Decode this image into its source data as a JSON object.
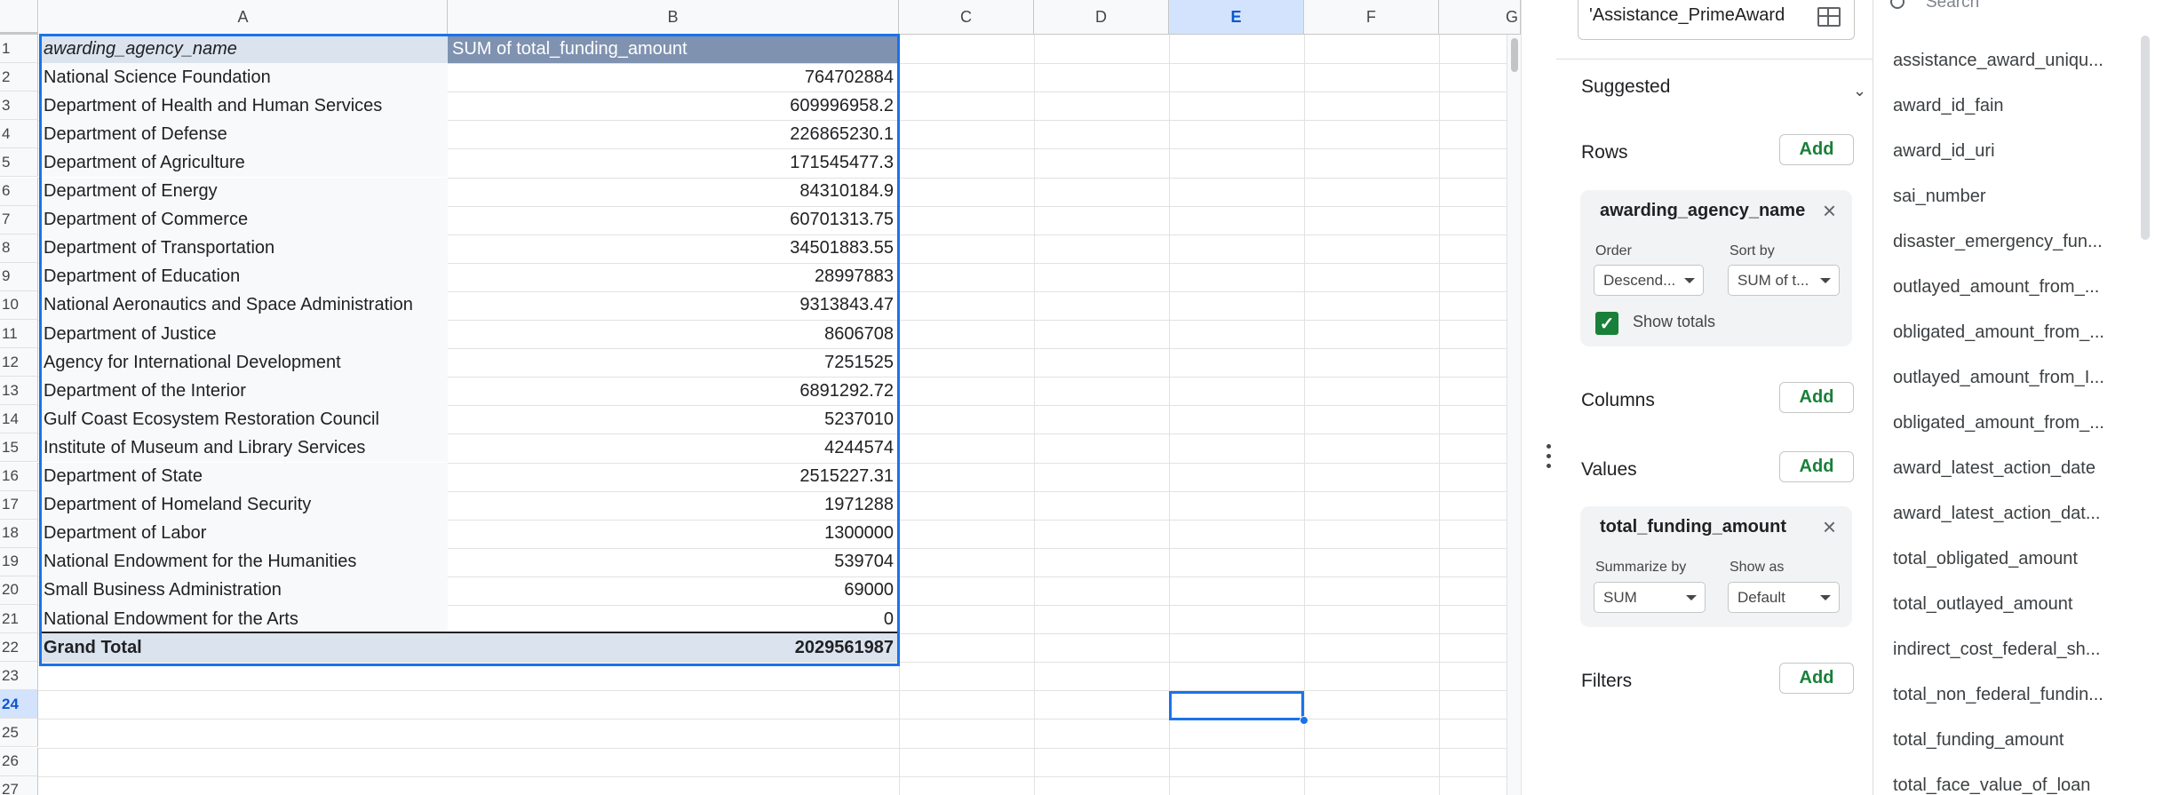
{
  "sheet": {
    "columns": [
      "A",
      "B",
      "C",
      "D",
      "E",
      "F",
      "G"
    ],
    "selected_column": "E",
    "selected_row": "24",
    "rows": [
      "1",
      "2",
      "3",
      "4",
      "5",
      "6",
      "7",
      "8",
      "9",
      "10",
      "11",
      "12",
      "13",
      "14",
      "15",
      "16",
      "17",
      "18",
      "19",
      "20",
      "21",
      "22",
      "23",
      "24",
      "25",
      "26",
      "27"
    ],
    "pivot": {
      "header_a": "awarding_agency_name",
      "header_b": "SUM of total_funding_amount",
      "data": [
        {
          "agency": "National Science Foundation",
          "amount": "764702884"
        },
        {
          "agency": "Department of Health and Human Services",
          "amount": "609996958.2"
        },
        {
          "agency": "Department of Defense",
          "amount": "226865230.1"
        },
        {
          "agency": "Department of Agriculture",
          "amount": "171545477.3"
        },
        {
          "agency": "Department of Energy",
          "amount": "84310184.9"
        },
        {
          "agency": "Department of Commerce",
          "amount": "60701313.75"
        },
        {
          "agency": "Department of Transportation",
          "amount": "34501883.55"
        },
        {
          "agency": "Department of Education",
          "amount": "28997883"
        },
        {
          "agency": "National Aeronautics and Space Administration",
          "amount": "9313843.47"
        },
        {
          "agency": "Department of Justice",
          "amount": "8606708"
        },
        {
          "agency": "Agency for International Development",
          "amount": "7251525"
        },
        {
          "agency": "Department of the Interior",
          "amount": "6891292.72"
        },
        {
          "agency": "Gulf Coast Ecosystem Restoration Council",
          "amount": "5237010"
        },
        {
          "agency": "Institute of Museum and Library Services",
          "amount": "4244574"
        },
        {
          "agency": "Department of State",
          "amount": "2515227.31"
        },
        {
          "agency": "Department of Homeland Security",
          "amount": "1971288"
        },
        {
          "agency": "Department of Labor",
          "amount": "1300000"
        },
        {
          "agency": "National Endowment for the Humanities",
          "amount": "539704"
        },
        {
          "agency": "Small Business Administration",
          "amount": "69000"
        },
        {
          "agency": "National Endowment for the Arts",
          "amount": "0"
        }
      ],
      "grand_total_label": "Grand Total",
      "grand_total_value": "2029561987"
    }
  },
  "editor": {
    "range_value": "'Assistance_PrimeAward",
    "suggested_label": "Suggested",
    "rows_label": "Rows",
    "columns_label": "Columns",
    "values_label": "Values",
    "filters_label": "Filters",
    "add_label": "Add",
    "row_card": {
      "field": "awarding_agency_name",
      "order_label": "Order",
      "order_value": "Descend...",
      "sortby_label": "Sort by",
      "sortby_value": "SUM of t...",
      "show_totals_label": "Show totals",
      "show_totals_checked": true
    },
    "value_card": {
      "field": "total_funding_amount",
      "summarize_label": "Summarize by",
      "summarize_value": "SUM",
      "showas_label": "Show as",
      "showas_value": "Default"
    }
  },
  "field_list": {
    "search_placeholder": "Search",
    "items": [
      "assistance_award_uniqu...",
      "award_id_fain",
      "award_id_uri",
      "sai_number",
      "disaster_emergency_fun...",
      "outlayed_amount_from_...",
      "obligated_amount_from_...",
      "outlayed_amount_from_I...",
      "obligated_amount_from_...",
      "award_latest_action_date",
      "award_latest_action_dat...",
      "total_obligated_amount",
      "total_outlayed_amount",
      "indirect_cost_federal_sh...",
      "total_non_federal_fundin...",
      "total_funding_amount",
      "total_face_value_of_loan"
    ]
  },
  "colors": {
    "accent": "#1a73e8",
    "add_green": "#188038",
    "pivot_header": "#7f92b0",
    "pivot_band": "#dbe3ee"
  }
}
